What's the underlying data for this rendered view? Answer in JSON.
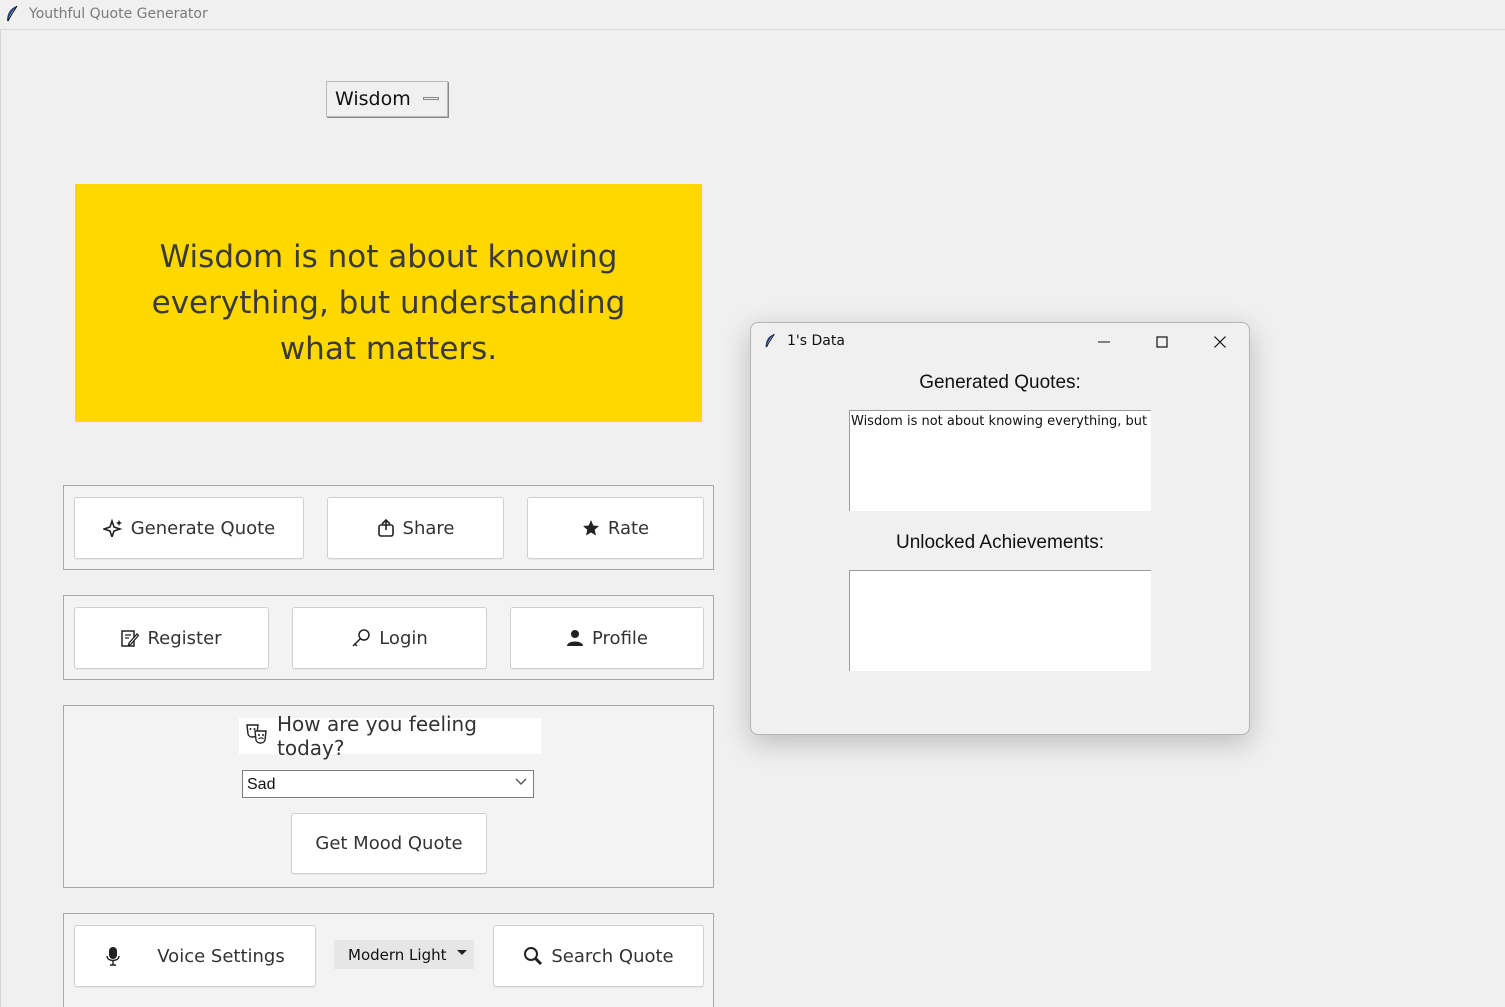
{
  "window": {
    "title": "Youthful Quote Generator",
    "icon": "feather-icon"
  },
  "category_menu": {
    "selected": "Wisdom"
  },
  "quote": {
    "text": "Wisdom is not about knowing everything, but understanding what matters.",
    "background": "#ffd800"
  },
  "actions_row1": [
    {
      "label": "Generate Quote",
      "icon": "sparkle-icon"
    },
    {
      "label": "Share",
      "icon": "share-icon"
    },
    {
      "label": "Rate",
      "icon": "star-icon"
    }
  ],
  "actions_row2": [
    {
      "label": "Register",
      "icon": "edit-form-icon"
    },
    {
      "label": "Login",
      "icon": "key-icon"
    },
    {
      "label": "Profile",
      "icon": "user-icon"
    }
  ],
  "mood": {
    "label": "How are you feeling today?",
    "icon": "theater-masks-icon",
    "selected": "Sad",
    "button": "Get Mood Quote"
  },
  "bottom_bar": {
    "voice_button": "Voice Settings",
    "theme_selected": "Modern Light",
    "search_button": "Search Quote"
  },
  "data_window": {
    "title": "1's Data",
    "generated_heading": "Generated Quotes:",
    "generated_text": "Wisdom is not about knowing everything, but understanding what matters.",
    "achievements_heading": "Unlocked Achievements:",
    "achievements_text": ""
  }
}
